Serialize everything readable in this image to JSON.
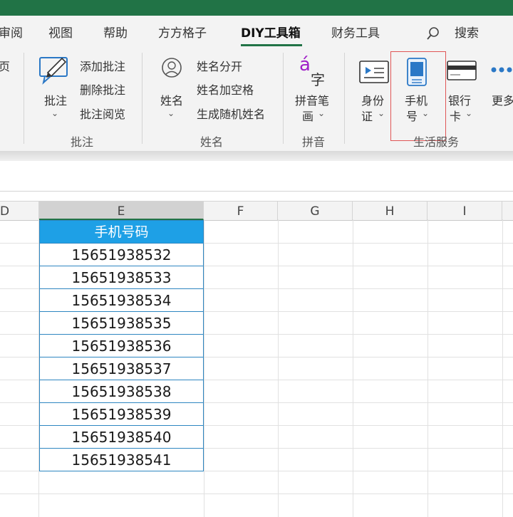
{
  "ribbon_tabs": {
    "review_partial": "审阅",
    "view": "视图",
    "help": "帮助",
    "fangfang": "方方格子",
    "diy": "DIY工具箱",
    "finance": "财务工具",
    "search": "搜索"
  },
  "left_partial": "页",
  "comments": {
    "big_label": "批注",
    "add": "添加批注",
    "delete": "删除批注",
    "browse": "批注阅览",
    "group": "批注"
  },
  "names": {
    "big_label": "姓名",
    "split": "姓名分开",
    "add_space": "姓名加空格",
    "random": "生成随机姓名",
    "group": "姓名"
  },
  "pinyin": {
    "icon_letter": "á",
    "icon_char": "字",
    "label_line1": "拼音笔",
    "label_line2": "画",
    "group": "拼音"
  },
  "life": {
    "id_line1": "身份",
    "id_line2": "证",
    "phone_line1": "手机",
    "phone_line2": "号",
    "bank_line1": "银行",
    "bank_line2": "卡",
    "more": "更多",
    "group": "生活服务"
  },
  "columns": [
    "D",
    "E",
    "F",
    "G",
    "H",
    "I"
  ],
  "sheet": {
    "header": "手机号码",
    "numbers": [
      "15651938532",
      "15651938533",
      "15651938534",
      "15651938535",
      "15651938536",
      "15651938537",
      "15651938538",
      "15651938539",
      "15651938540",
      "15651938541"
    ]
  },
  "colors": {
    "excel_green": "#217346",
    "header_fill": "#1ea0e6",
    "table_border": "#2e86c1",
    "highlight_box": "#e05656"
  }
}
